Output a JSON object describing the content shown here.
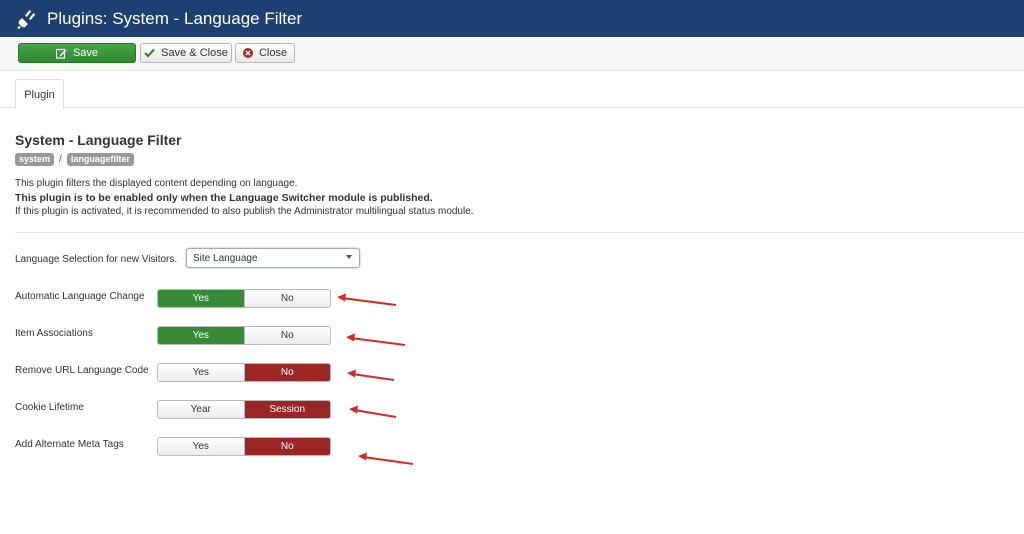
{
  "header": {
    "title": "Plugins: System - Language Filter",
    "icon": "plug-icon"
  },
  "toolbar": {
    "save_label": "Save",
    "save_close_label": "Save & Close",
    "close_label": "Close"
  },
  "tabs": [
    {
      "label": "Plugin",
      "active": true
    }
  ],
  "plugin": {
    "title": "System - Language Filter",
    "badges": [
      "system",
      "languagefilter"
    ],
    "separator": "/",
    "desc1": "This plugin filters the displayed content depending on language.",
    "desc2": "This plugin is to be enabled only when the Language Switcher module is published.",
    "desc3": "If this plugin is activated, it is recommended to also publish the Administrator multilingual status module."
  },
  "fields": {
    "language_selection": {
      "label": "Language Selection for new Visitors.",
      "value": "Site Language"
    },
    "toggles": [
      {
        "label": "Automatic Language Change",
        "options": [
          "Yes",
          "No"
        ],
        "selected": "Yes"
      },
      {
        "label": "Item Associations",
        "options": [
          "Yes",
          "No"
        ],
        "selected": "Yes"
      },
      {
        "label": "Remove URL Language Code",
        "options": [
          "Yes",
          "No"
        ],
        "selected": "No"
      },
      {
        "label": "Cookie Lifetime",
        "options": [
          "Year",
          "Session"
        ],
        "selected": "Session"
      },
      {
        "label": "Add Alternate Meta Tags",
        "options": [
          "Yes",
          "No"
        ],
        "selected": "No"
      }
    ]
  },
  "colors": {
    "header_bg": "#1d3f72",
    "success": "#378a37",
    "danger": "#9b2424",
    "annotation_arrow": "#d42a2a"
  }
}
